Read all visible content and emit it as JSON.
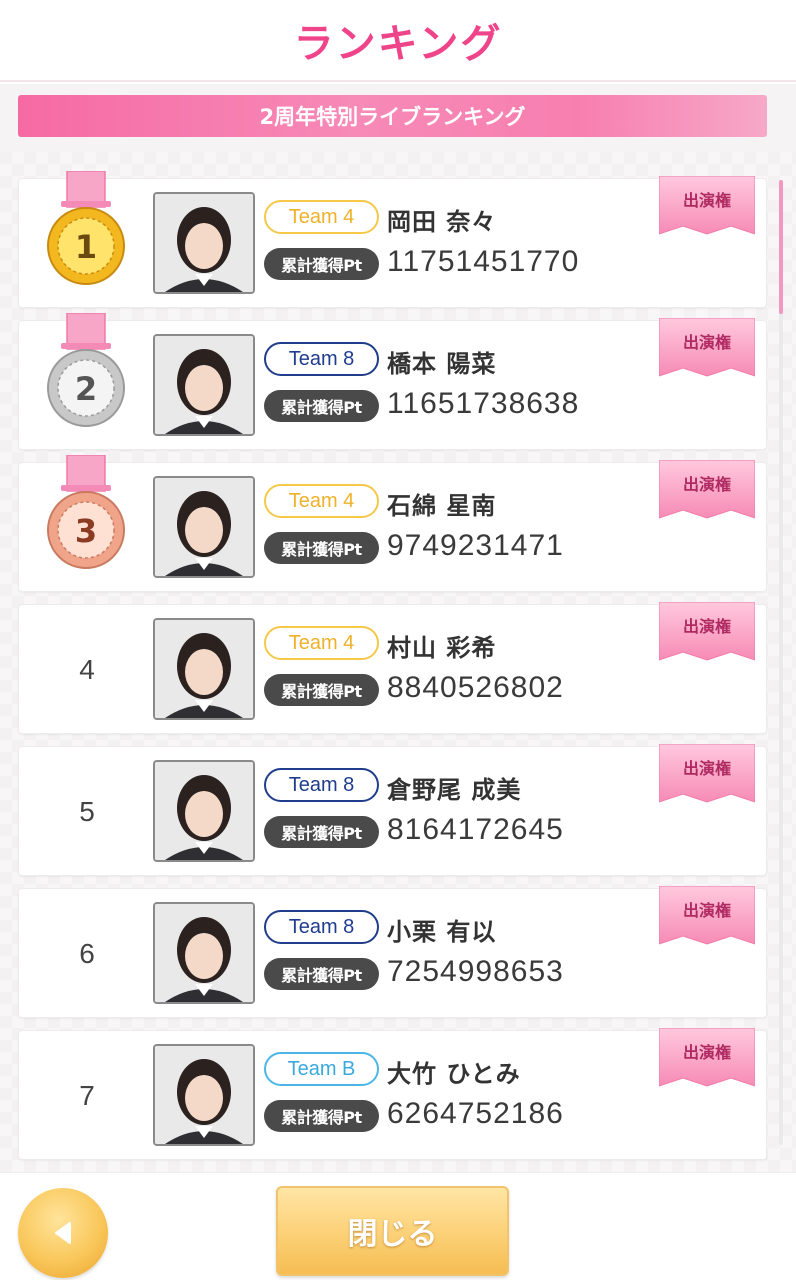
{
  "header": {
    "title": "ランキング"
  },
  "banner": {
    "label": "2周年特別ライブランキング"
  },
  "pt_label": "累計獲得Pt",
  "ribbon_label": "出演権",
  "rankings": [
    {
      "rank": "1",
      "team": "Team 4",
      "team_class": "team-4",
      "name": "岡田 奈々",
      "points": "11751451770",
      "medal": "gold"
    },
    {
      "rank": "2",
      "team": "Team 8",
      "team_class": "team-8",
      "name": "橋本 陽菜",
      "points": "11651738638",
      "medal": "silver"
    },
    {
      "rank": "3",
      "team": "Team 4",
      "team_class": "team-4",
      "name": "石綿 星南",
      "points": "9749231471",
      "medal": "bronze"
    },
    {
      "rank": "4",
      "team": "Team 4",
      "team_class": "team-4",
      "name": "村山 彩希",
      "points": "8840526802",
      "medal": ""
    },
    {
      "rank": "5",
      "team": "Team 8",
      "team_class": "team-8",
      "name": "倉野尾 成美",
      "points": "8164172645",
      "medal": ""
    },
    {
      "rank": "6",
      "team": "Team 8",
      "team_class": "team-8",
      "name": "小栗 有以",
      "points": "7254998653",
      "medal": ""
    },
    {
      "rank": "7",
      "team": "Team B",
      "team_class": "team-B",
      "name": "大竹 ひとみ",
      "points": "6264752186",
      "medal": ""
    }
  ],
  "footer": {
    "close_label": "閉じる",
    "back_icon": "back-arrow-icon"
  },
  "colors": {
    "accent_pink": "#f0448a",
    "gold": "#f9c75a",
    "team4": "#f6c84a",
    "team8": "#1f3d8c",
    "teamB": "#4bb7e6"
  }
}
